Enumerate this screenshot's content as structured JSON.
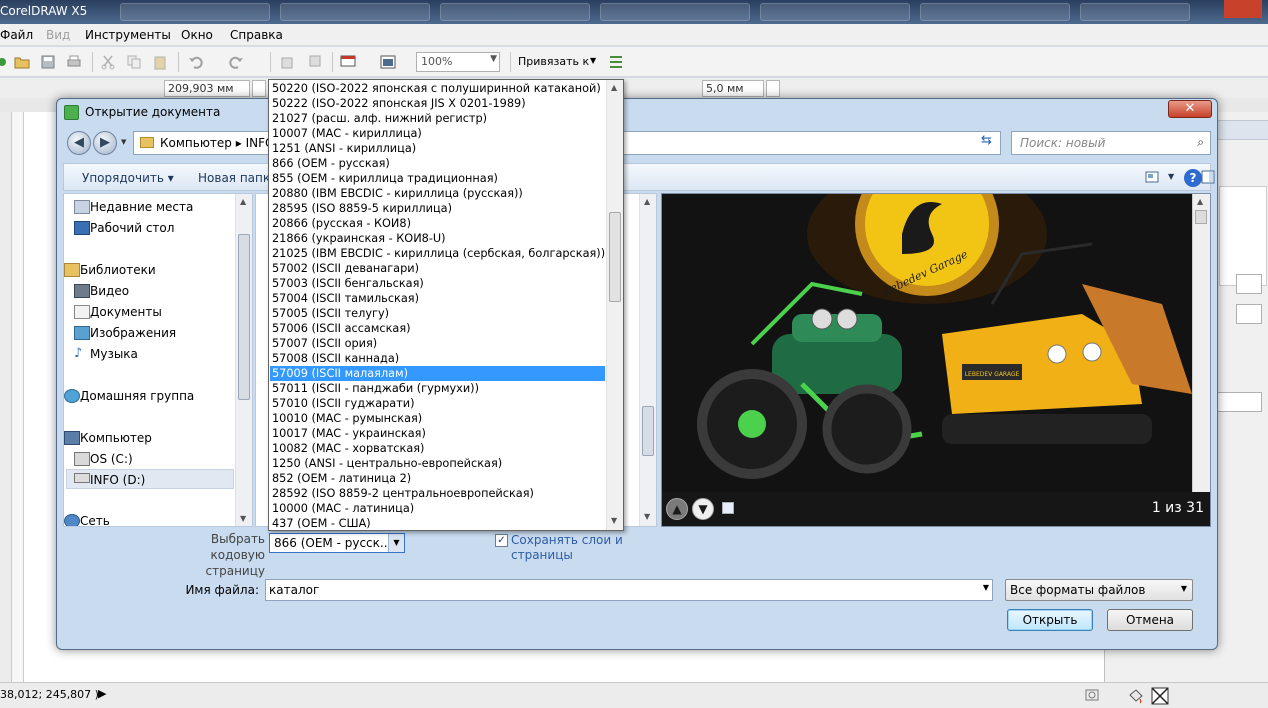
{
  "app": {
    "title": "CorelDRAW X5"
  },
  "menu": {
    "file": "Файл",
    "view": "Вид",
    "tools": "Инструменты",
    "window": "Окно",
    "help": "Справка"
  },
  "toolbar": {
    "zoom": "100%",
    "snap_to": "Привязать к"
  },
  "propbar": {
    "width": "209,903 мм",
    "nudge": "5,0 мм"
  },
  "status": {
    "coords": "38,012; 245,807 )"
  },
  "dialog": {
    "title": "Открытие документа",
    "close_glyph": "✕",
    "breadcrumb": "Компьютер  ▸  INFO (D:)",
    "search_placeholder": "Поиск: новый",
    "organize": "Упорядочить ▾",
    "new_folder": "Новая папка",
    "help_glyph": "?",
    "nav": {
      "recent": "Недавние места",
      "desktop": "Рабочий стол",
      "libraries": "Библиотеки",
      "video": "Видео",
      "documents": "Документы",
      "images": "Изображения",
      "music": "Музыка",
      "homegroup": "Домашняя группа",
      "computer": "Компьютер",
      "drive_c": "OS (C:)",
      "drive_d": "INFO (D:)",
      "network": "Сеть"
    },
    "preview": {
      "counter": "1 из 31",
      "logo_text": "Lebedev Garage",
      "plate_text": "LEBEDEV GARAGE"
    },
    "codepage_label": "Выбрать кодовую страницу",
    "codepage_value": "866   (OEM - русск...",
    "keep_layers": "Сохранять слои и страницы",
    "filename_label": "Имя файла:",
    "filename_value": "каталог",
    "filetype": "Все форматы файлов",
    "open_button": "Открыть",
    "cancel_button": "Отмена"
  },
  "codepages": [
    "50220 (ISO-2022 японская с полуширинной катаканой)",
    "50222 (ISO-2022 японская JIS X 0201-1989)",
    "21027 (расш. алф. нижний регистр)",
    "10007 (MAC - кириллица)",
    "1251  (ANSI - кириллица)",
    "866   (OEM - русская)",
    "855   (OEM - кириллица традиционная)",
    "20880 (IBM EBCDIC - кириллица (русская))",
    "28595 (ISO 8859-5 кириллица)",
    "20866 (русская - КОИ8)",
    "21866 (украинская - КОИ8-U)",
    "21025 (IBM EBCDIC - кириллица (сербская, болгарская))",
    "57002 (ISCII деванагари)",
    "57003 (ISCII бенгальская)",
    "57004 (ISCII тамильская)",
    "57005 (ISCII телугу)",
    "57006 (ISCII ассамская)",
    "57007 (ISCII ория)",
    "57008 (ISCII каннада)",
    "57009 (ISCII малаялам)",
    "57011 (ISCII - панджаби (гурмухи))",
    "57010 (ISCII гуджарати)",
    "10010 (MAC - румынская)",
    "10017 (MAC - украинская)",
    "10082 (MAC - хорватская)",
    "1250  (ANSI - центрально-европейская)",
    "852   (OEM - латиница 2)",
    "28592 (ISO 8859-2 центральноевропейская)",
    "10000 (MAC - латиница)",
    "437   (OEM - США)"
  ],
  "codepage_selected_index": 19,
  "colors": {
    "selection": "#3399ff",
    "dialog_frame": "#c9dbef",
    "logo_yellow": "#f2c515",
    "atv_green": "#2e8b57"
  }
}
